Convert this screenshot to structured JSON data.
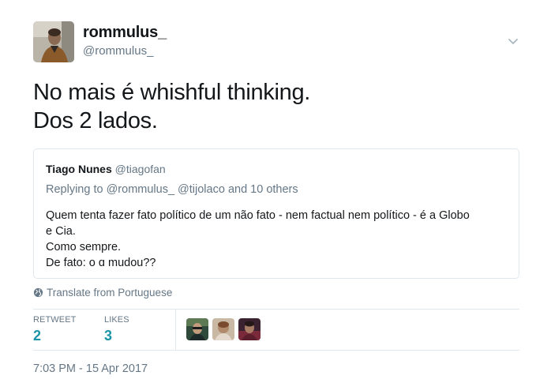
{
  "author": {
    "name": "rommulus_",
    "handle": "@rommulus_",
    "avatar": "profile-photo"
  },
  "tweet": {
    "lines": [
      "No mais é whishful thinking.",
      "Dos 2 lados."
    ]
  },
  "quoted_tweet": {
    "name": "Tiago Nunes",
    "handle": "@tiagofan",
    "reply_prefix": "Replying to",
    "reply_user1": "@rommulus_",
    "reply_user2": "@tijolaco",
    "reply_suffix": "and 10 others",
    "body_lines": [
      "Quem tenta fazer fato político de um não fato - nem factual nem político - é a Globo",
      "e Cia.",
      "Como sempre.",
      "De fato: o ɑ mudou??"
    ]
  },
  "translate": {
    "icon": "globe-icon",
    "label": "Translate from Portuguese"
  },
  "stats": {
    "retweets_label": "RETWEET",
    "retweets": "2",
    "likes_label": "LIKES",
    "likes": "3"
  },
  "likers": [
    "liker-avatar-1",
    "liker-avatar-2",
    "liker-avatar-3"
  ],
  "timestamp": "7:03 PM - 15 Apr 2017",
  "colors": {
    "text": "#14171a",
    "muted": "#657786",
    "border": "#e1e8ed",
    "stat_accent": "#1c94a8"
  }
}
